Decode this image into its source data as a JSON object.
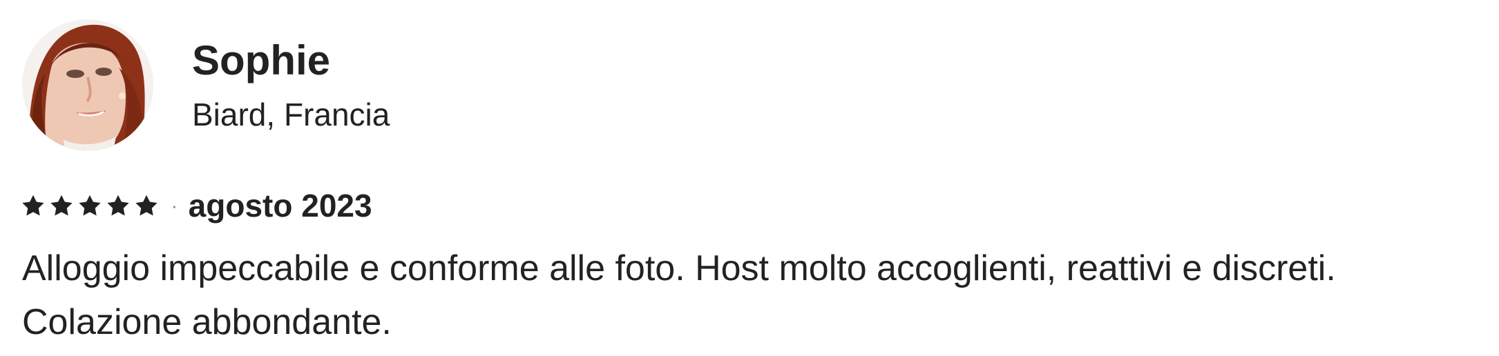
{
  "reviewer": {
    "name": "Sophie",
    "location": "Biard, Francia",
    "avatar_icon": "reviewer-photo"
  },
  "rating": {
    "stars": 5,
    "max_stars": 5,
    "star_icon": "star-icon",
    "separator": "·",
    "date": "agosto 2023"
  },
  "review": {
    "line1": "Alloggio impeccabile e conforme alle foto. Host molto accoglienti, reattivi e discreti.",
    "line2": "Colazione abbondante."
  },
  "colors": {
    "text": "#222222",
    "separator": "#717171",
    "background": "#ffffff"
  }
}
